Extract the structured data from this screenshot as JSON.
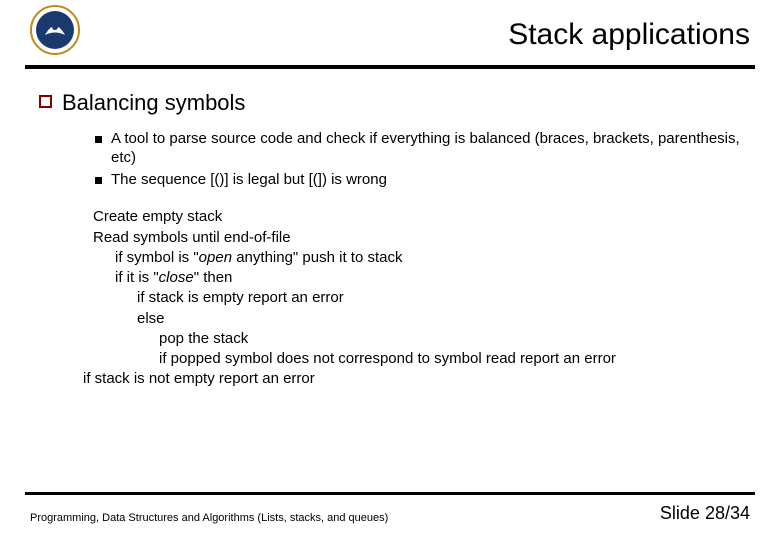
{
  "title": "Stack applications",
  "main_bullet": "Balancing symbols",
  "sub_items": [
    "A tool to parse source code and check if everything is balanced (braces, brackets, parenthesis, etc)",
    "The sequence [()] is legal but [(]) is wrong"
  ],
  "algo": {
    "l1": "Create empty stack",
    "l2": "Read symbols until end-of-file",
    "l3_a": "if symbol is \"",
    "l3_open_word": "open",
    "l3_b": " anything\" push it to stack",
    "l4_a": "if it is \"",
    "l4_close_word": "close",
    "l4_b": "\" then",
    "l5": "if stack is empty report an error",
    "l6": "else",
    "l7": "pop the stack",
    "l8": "if popped symbol does not correspond to symbol  read report an error",
    "l9": "if stack is not empty report an error"
  },
  "footer_course": "Programming, Data Structures and Algorithms  (Lists, stacks, and queues)",
  "footer_slide": "Slide 28/34"
}
